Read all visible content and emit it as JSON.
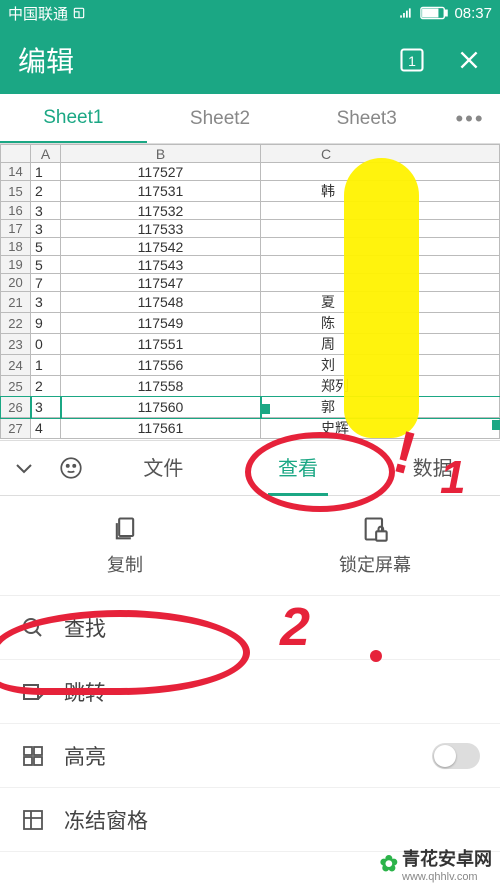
{
  "status": {
    "carrier": "中国联通",
    "time": "08:37"
  },
  "appbar": {
    "title": "编辑",
    "page_badge": "1"
  },
  "tabs": [
    "Sheet1",
    "Sheet2",
    "Sheet3"
  ],
  "active_tab": 0,
  "columns": [
    "",
    "A",
    "B",
    "C"
  ],
  "rows": [
    {
      "n": 14,
      "a": "1",
      "b": "117527",
      "c": ""
    },
    {
      "n": 15,
      "a": "2",
      "b": "117531",
      "c": "韩"
    },
    {
      "n": 16,
      "a": "3",
      "b": "117532",
      "c": ""
    },
    {
      "n": 17,
      "a": "3",
      "b": "117533",
      "c": ""
    },
    {
      "n": 18,
      "a": "5",
      "b": "117542",
      "c": ""
    },
    {
      "n": 19,
      "a": "5",
      "b": "117543",
      "c": ""
    },
    {
      "n": 20,
      "a": "7",
      "b": "117547",
      "c": ""
    },
    {
      "n": 21,
      "a": "3",
      "b": "117548",
      "c": "夏"
    },
    {
      "n": 22,
      "a": "9",
      "b": "117549",
      "c": "陈"
    },
    {
      "n": 23,
      "a": "0",
      "b": "117551",
      "c": "周"
    },
    {
      "n": 24,
      "a": "1",
      "b": "117556",
      "c": "刘"
    },
    {
      "n": 25,
      "a": "2",
      "b": "117558",
      "c": "郑列"
    },
    {
      "n": 26,
      "a": "3",
      "b": "117560",
      "c": "郭"
    },
    {
      "n": 27,
      "a": "4",
      "b": "117561",
      "c": "史辉"
    }
  ],
  "selected_row_index": 12,
  "toolbar_tabs": {
    "file": "文件",
    "view": "查看",
    "data": "数据"
  },
  "active_toolbar_tab": "view",
  "quick": {
    "copy": "复制",
    "lock": "锁定屏幕"
  },
  "menu": {
    "find": "查找",
    "jump": "跳转",
    "highlight": "高亮",
    "freeze": "冻结窗格"
  },
  "annotations": {
    "mark1": "!",
    "num1": "1",
    "num2": "2"
  },
  "watermark": {
    "name": "青花安卓网",
    "url": "www.qhhlv.com"
  }
}
